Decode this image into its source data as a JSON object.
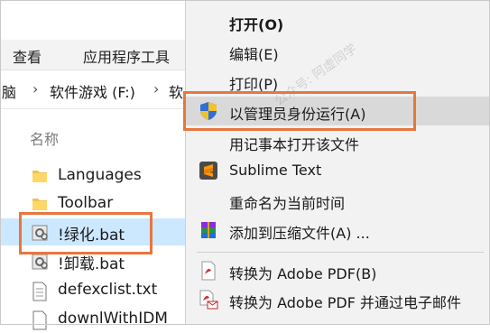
{
  "ribbon": {
    "tab_view": "查看",
    "tab_app_tools": "应用程序工具"
  },
  "address": {
    "frag_pc": "脑",
    "frag_drive": "软件游戏 (F:)",
    "frag_next": "软"
  },
  "file_list": {
    "column_name": "名称",
    "files": [
      {
        "name": "Languages",
        "icon": "folder-icon"
      },
      {
        "name": "Toolbar",
        "icon": "folder-icon"
      },
      {
        "name": "!绿化.bat",
        "icon": "gear-file-icon",
        "selected": true
      },
      {
        "name": "!卸载.bat",
        "icon": "gear-file-icon"
      },
      {
        "name": "defexclist.txt",
        "icon": "text-file-icon"
      },
      {
        "name": "downlWithIDM",
        "icon": "text-file-icon"
      }
    ]
  },
  "context_menu": {
    "items": [
      {
        "label": "打开(O)",
        "bold": true
      },
      {
        "label": "编辑(E)"
      },
      {
        "label": "打印(P)"
      },
      {
        "label": "以管理员身份运行(A)",
        "icon": "shield-icon",
        "highlighted": true
      },
      {
        "label": "用记事本打开该文件"
      },
      {
        "label": "Sublime Text",
        "icon": "sublime-icon"
      },
      {
        "label": "重命名为当前时间"
      },
      {
        "label": "添加到压缩文件(A) ...",
        "icon": "archive-icon"
      },
      {
        "label": "转换为 Adobe PDF(B)",
        "icon": "pdf-icon"
      },
      {
        "label": "转换为 Adobe PDF 并通过电子邮件",
        "icon": "pdf-mail-icon"
      }
    ]
  },
  "watermark": "公众号: 阿虚同学",
  "colors": {
    "accent_orange": "#e8763d",
    "selection_blue": "#cce8ff",
    "menu_bg": "#f2f2f2",
    "menu_hover": "#d9d9d9"
  }
}
